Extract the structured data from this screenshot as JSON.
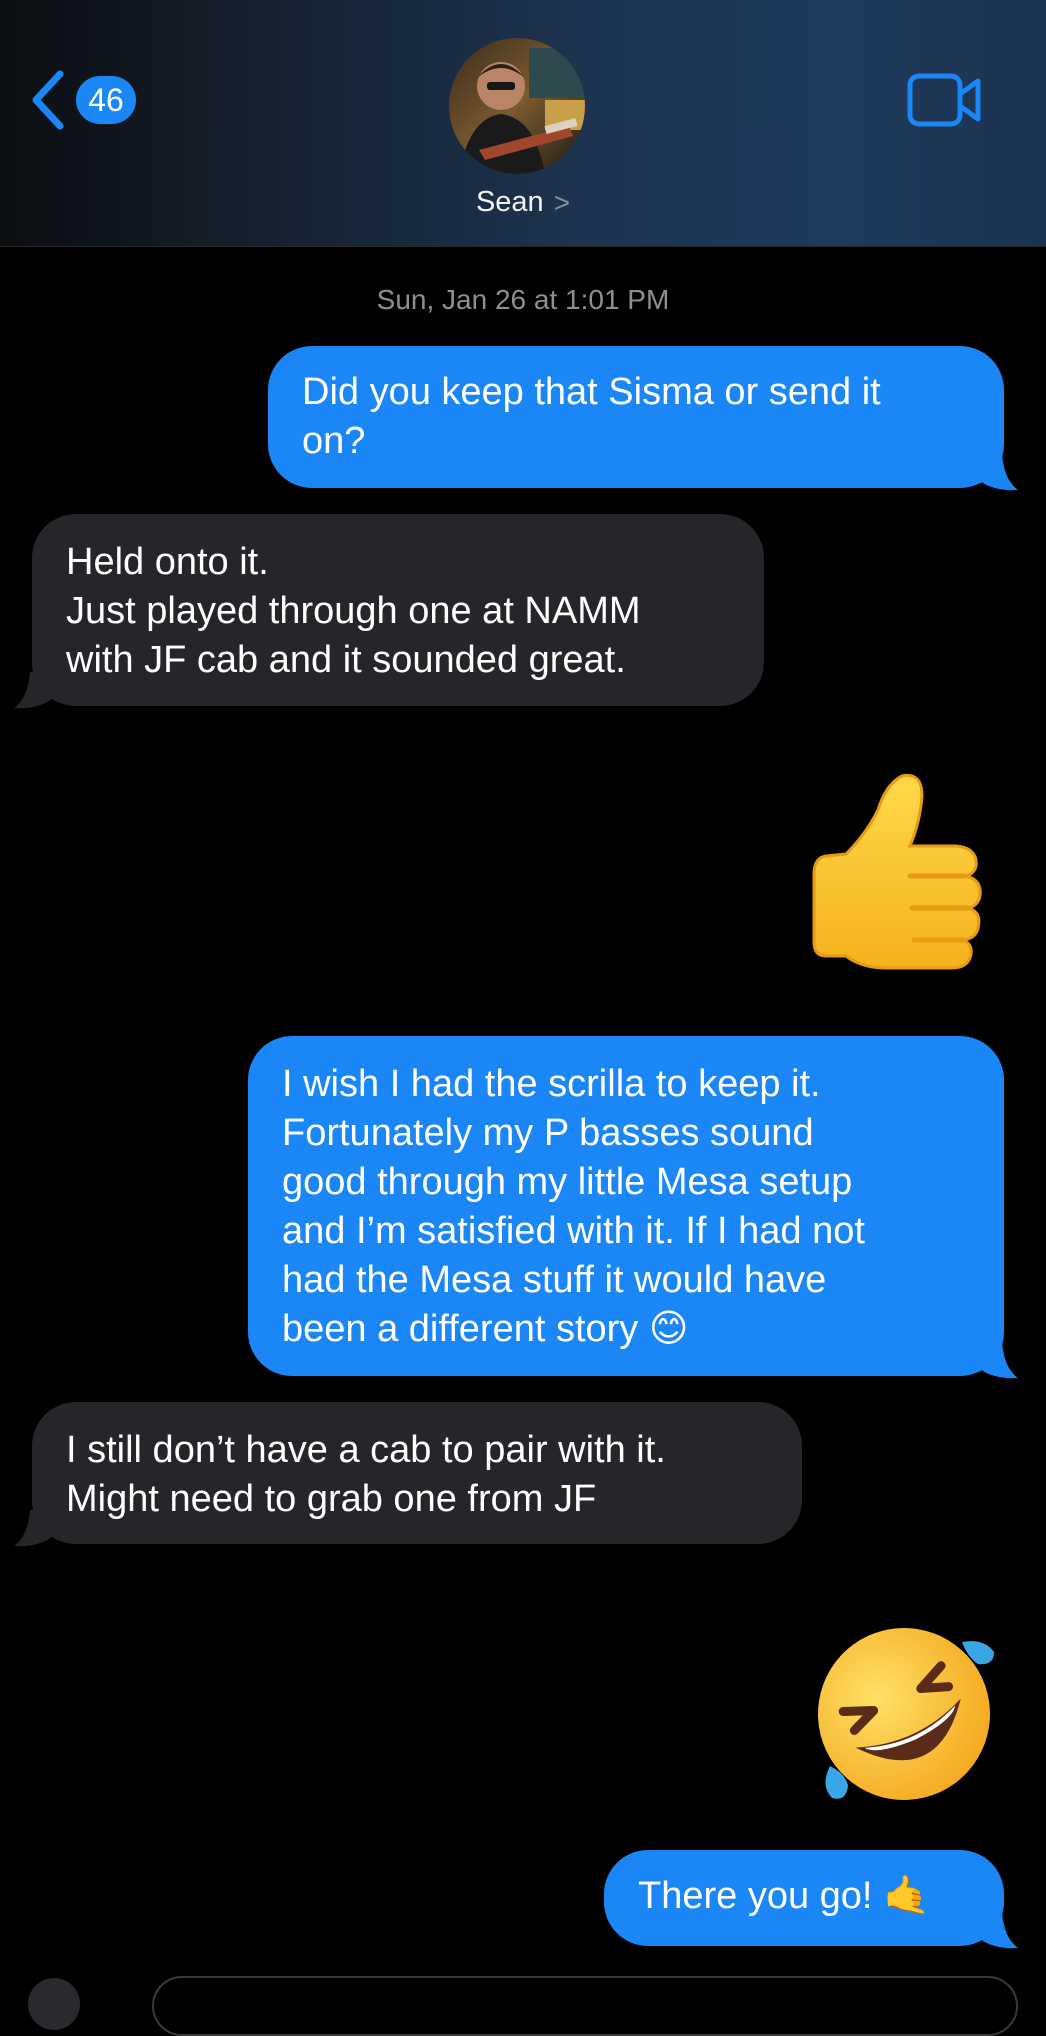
{
  "header": {
    "back_count": "46",
    "contact_name": "Sean",
    "contact_chevron": ">",
    "back_icon": "chevron-left-icon",
    "video_icon": "video-camera-icon",
    "accent_color": "#1b86f5"
  },
  "conversation": {
    "timestamp": "Sun, Jan 26 at 1:01 PM",
    "messages": [
      {
        "direction": "sent",
        "text": "Did you keep that Sisma or send it\non?"
      },
      {
        "direction": "received",
        "text": "Held onto it.\nJust played through one at NAMM\nwith JF cab and it sounded great."
      },
      {
        "direction": "sent",
        "emoji": "thumbs-up"
      },
      {
        "direction": "sent",
        "text": "I wish I had the scrilla to keep it.\nFortunately my P basses sound\ngood through my little Mesa setup\nand I’m satisfied with it. If I had not\nhad the Mesa stuff it would have\nbeen a different story 😊"
      },
      {
        "direction": "received",
        "text": "I still don’t have a cab to pair with it.\nMight need to grab one from JF"
      },
      {
        "direction": "sent",
        "emoji": "rolling-on-the-floor-laughing"
      },
      {
        "direction": "sent",
        "text": "There you go! 🤙"
      }
    ]
  },
  "colors": {
    "sent_bubble": "#1b86f5",
    "received_bubble": "#26252a",
    "background": "#000000"
  }
}
